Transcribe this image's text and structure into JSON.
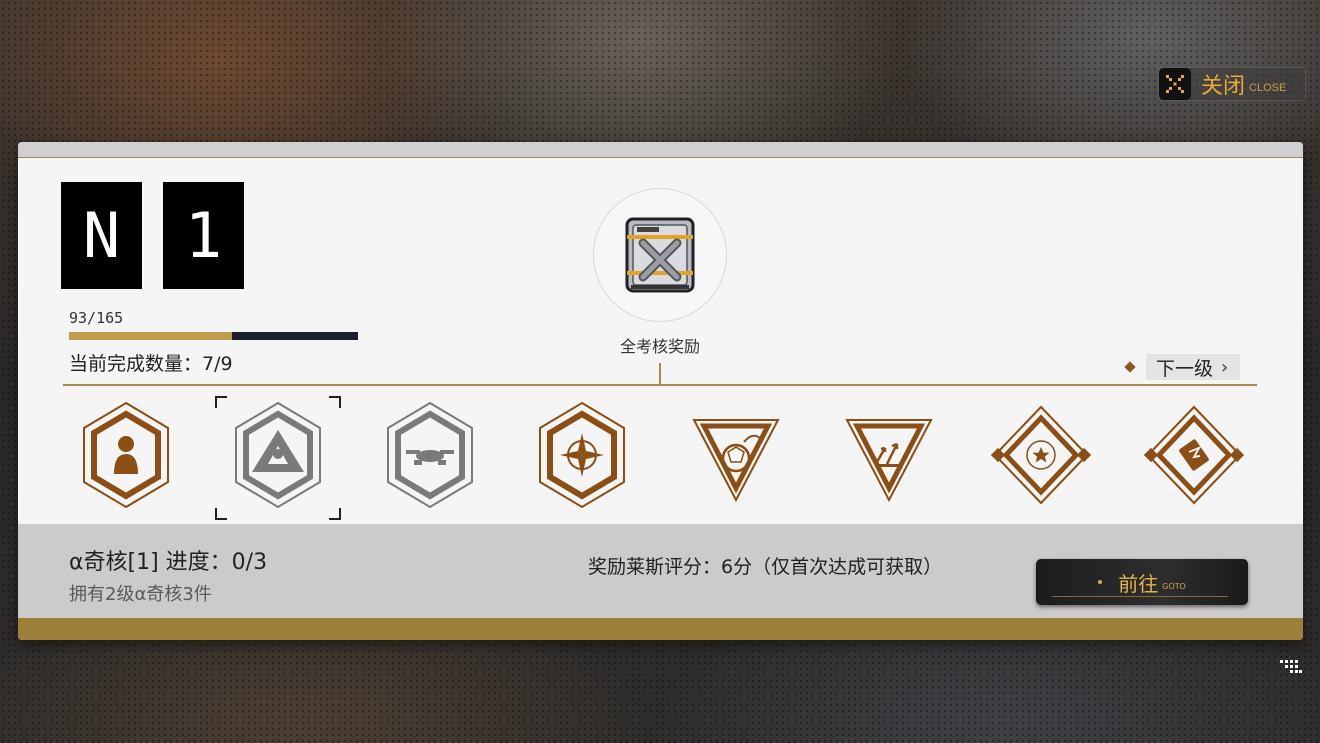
{
  "close": {
    "label": "关闭",
    "sub": "CLOSE",
    "icon": "close-x-icon"
  },
  "rank": {
    "letter": "N",
    "number": "1"
  },
  "progress": {
    "text": "93/165",
    "current": 93,
    "max": 165
  },
  "completed": {
    "text": "当前完成数量：7/9"
  },
  "reward": {
    "label": "全考核奖励",
    "icon": "supply-crate-icon"
  },
  "next_level": {
    "label": "下一级",
    "chevron": "›"
  },
  "badges": [
    {
      "name": "badge-person-hexagon",
      "selected": false
    },
    {
      "name": "badge-triangle-hexagon",
      "selected": true
    },
    {
      "name": "badge-drone-hexagon",
      "selected": false
    },
    {
      "name": "badge-compass-hexagon",
      "selected": false
    },
    {
      "name": "badge-ball-triangle",
      "selected": false
    },
    {
      "name": "badge-arrows-triangle",
      "selected": false
    },
    {
      "name": "badge-star-diamond",
      "selected": false
    },
    {
      "name": "badge-card-diamond",
      "selected": false
    }
  ],
  "task": {
    "title": "α奇核[1] 进度：0/3",
    "subtitle": "拥有2级α奇核3件",
    "reward_text": "奖励莱斯评分：6分（仅首次达成可获取）"
  },
  "goto": {
    "label": "前往",
    "sub": "GOTO"
  },
  "colors": {
    "accent_gold": "#a98a52",
    "badge_brown": "#8b4e14",
    "badge_gray": "#7a7a7a",
    "goto_text": "#e8b34a"
  }
}
